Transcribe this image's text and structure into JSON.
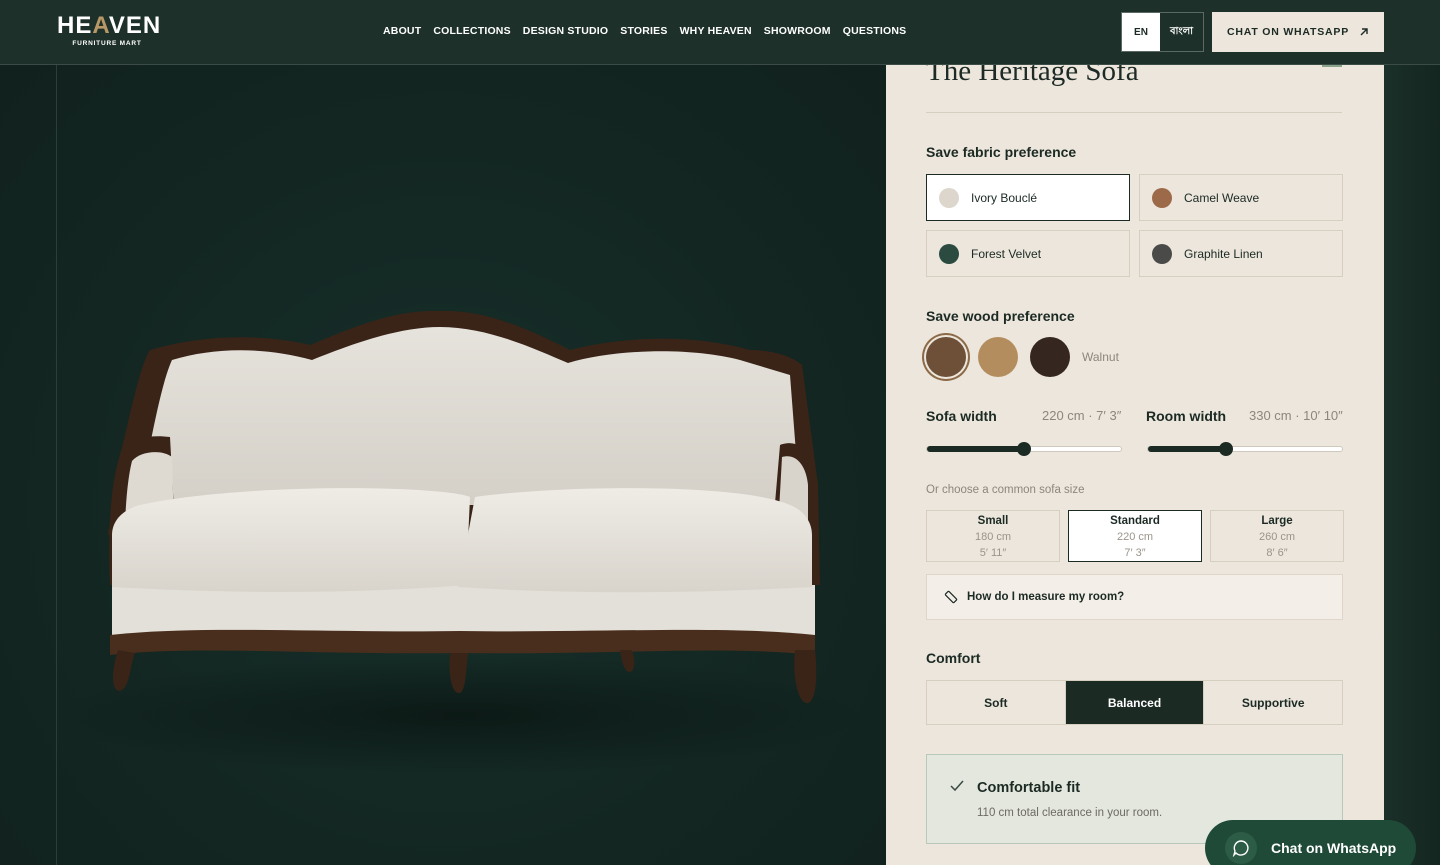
{
  "header": {
    "logo_word_a": "HE",
    "logo_word_accent": "A",
    "logo_word_b": "VEN",
    "logo_sub": "FURNITURE MART",
    "nav": [
      "ABOUT",
      "COLLECTIONS",
      "DESIGN STUDIO",
      "STORIES",
      "WHY HEAVEN",
      "SHOWROOM",
      "QUESTIONS"
    ],
    "lang_en": "EN",
    "lang_bn": "বাংলা",
    "whatsapp_label": "CHAT ON WHATSAPP"
  },
  "product": {
    "title": "The Heritage Sofa"
  },
  "fabric": {
    "heading": "Save fabric preference",
    "options": [
      {
        "label": "Ivory Bouclé",
        "color": "#dcd6cc",
        "selected": true
      },
      {
        "label": "Camel Weave",
        "color": "#9c6a48",
        "selected": false
      },
      {
        "label": "Forest Velvet",
        "color": "#2b4a40",
        "selected": false
      },
      {
        "label": "Graphite Linen",
        "color": "#4a4a48",
        "selected": false
      }
    ]
  },
  "wood": {
    "heading": "Save wood preference",
    "options": [
      {
        "color": "#6e4f38",
        "selected": true
      },
      {
        "color": "#b48d5e",
        "selected": false
      },
      {
        "color": "#362620",
        "selected": false
      }
    ],
    "selected_name": "Walnut"
  },
  "sofa_width": {
    "label": "Sofa width",
    "value": "220 cm · 7′ 3″",
    "position": 0.5
  },
  "room_width": {
    "label": "Room width",
    "value": "330 cm · 10′ 10″",
    "position": 0.4
  },
  "sizes": {
    "hint": "Or choose a common sofa size",
    "options": [
      {
        "name": "Small",
        "cm": "180 cm",
        "ft": "5′ 11″",
        "selected": false
      },
      {
        "name": "Standard",
        "cm": "220 cm",
        "ft": "7′ 3″",
        "selected": true
      },
      {
        "name": "Large",
        "cm": "260 cm",
        "ft": "8′ 6″",
        "selected": false
      }
    ]
  },
  "measure_link": "How do I measure my room?",
  "comfort": {
    "heading": "Comfort",
    "options": [
      "Soft",
      "Balanced",
      "Supportive"
    ],
    "selected": "Balanced"
  },
  "fit": {
    "title": "Comfortable fit",
    "description": "110 cm total clearance in your room."
  },
  "chat_float": "Chat on WhatsApp",
  "colors": {
    "brand_dark": "#1c2a24",
    "panel_bg": "#ece6dc",
    "accent_gold": "#b89866",
    "whatsapp_green": "#1f4a38"
  }
}
